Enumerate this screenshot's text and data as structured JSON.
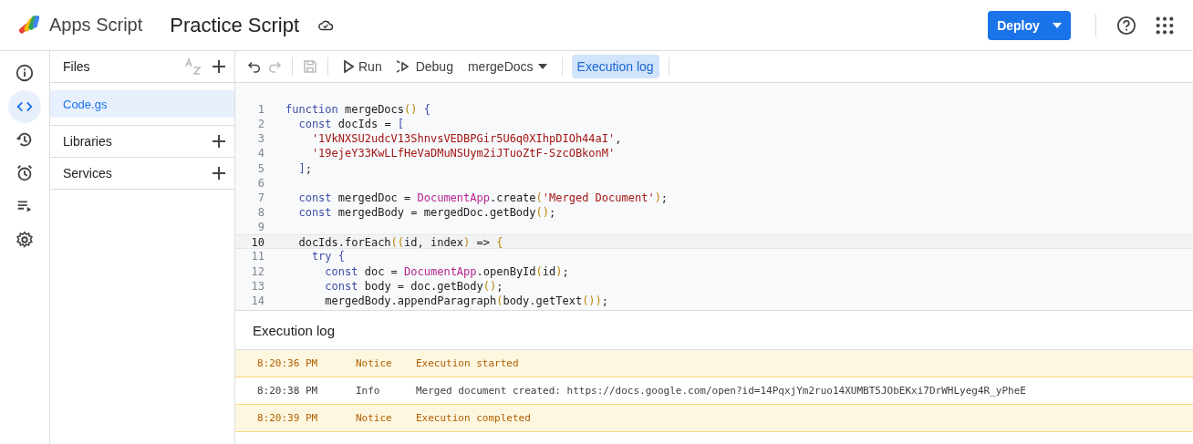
{
  "header": {
    "product": "Apps Script",
    "project_title": "Practice Script",
    "deploy_button": "Deploy"
  },
  "rail": [
    {
      "selected": false
    },
    {
      "selected": true
    },
    {
      "selected": false
    },
    {
      "selected": false
    },
    {
      "selected": false
    },
    {
      "selected": false
    }
  ],
  "files_panel": {
    "title": "Files",
    "files": [
      {
        "name": "Code.gs",
        "selected": true
      }
    ],
    "sections": [
      "Libraries",
      "Services"
    ]
  },
  "toolbar": {
    "run": "Run",
    "debug": "Debug",
    "function_select": "mergeDocs",
    "execution_log_button": {
      "label": "Execution log",
      "selected": true
    }
  },
  "code": [
    {
      "number": "1",
      "selected": false,
      "tokens": [
        {
          "kind": "keyword",
          "text": "function"
        },
        {
          "kind": "plain",
          "text": " mergeDocs"
        },
        {
          "kind": "paren",
          "text": "()"
        },
        {
          "kind": "brace",
          "text": " {"
        }
      ]
    },
    {
      "number": "2",
      "selected": false,
      "tokens": [
        {
          "kind": "keyword",
          "text": "  const"
        },
        {
          "kind": "plain",
          "text": " docIds = "
        },
        {
          "kind": "brace",
          "text": "["
        }
      ]
    },
    {
      "number": "3",
      "selected": false,
      "tokens": [
        {
          "kind": "string",
          "text": "    '1VkNXSU2udcV13ShnvsVEDBPGir5U6q0XIhpDIOh44aI'"
        },
        {
          "kind": "plain",
          "text": ","
        }
      ]
    },
    {
      "number": "4",
      "selected": false,
      "tokens": [
        {
          "kind": "string",
          "text": "    '19ejeY33KwLLfHeVaDMuNSUym2iJTuoZtF-SzcOBkonM'"
        }
      ]
    },
    {
      "number": "5",
      "selected": false,
      "tokens": [
        {
          "kind": "brace",
          "text": "  ]"
        },
        {
          "kind": "plain",
          "text": ";"
        }
      ]
    },
    {
      "number": "6",
      "selected": false
    },
    {
      "number": "7",
      "selected": false,
      "tokens": [
        {
          "kind": "keyword",
          "text": "  const"
        },
        {
          "kind": "plain",
          "text": " mergedDoc = "
        },
        {
          "kind": "class",
          "text": "DocumentApp"
        },
        {
          "kind": "plain",
          "text": ".create"
        },
        {
          "kind": "paren",
          "text": "("
        },
        {
          "kind": "string",
          "text": "'Merged Document'"
        },
        {
          "kind": "paren",
          "text": ")"
        },
        {
          "kind": "plain",
          "text": ";"
        }
      ]
    },
    {
      "number": "8",
      "selected": false,
      "tokens": [
        {
          "kind": "keyword",
          "text": "  const"
        },
        {
          "kind": "plain",
          "text": " mergedBody = mergedDoc.getBody"
        },
        {
          "kind": "paren",
          "text": "()"
        },
        {
          "kind": "plain",
          "text": ";"
        }
      ]
    },
    {
      "number": "9",
      "selected": false
    },
    {
      "number": "10",
      "selected": true,
      "tokens": [
        {
          "kind": "plain",
          "text": "  docIds.forEach"
        },
        {
          "kind": "paren",
          "text": "(("
        },
        {
          "kind": "plain",
          "text": "id, index"
        },
        {
          "kind": "paren",
          "text": ")"
        },
        {
          "kind": "plain",
          "text": " => "
        },
        {
          "kind": "paren",
          "text": "{"
        }
      ]
    },
    {
      "number": "11",
      "selected": false,
      "tokens": [
        {
          "kind": "keyword",
          "text": "    try"
        },
        {
          "kind": "brace",
          "text": " {"
        }
      ]
    },
    {
      "number": "12",
      "selected": false,
      "tokens": [
        {
          "kind": "keyword",
          "text": "      const"
        },
        {
          "kind": "plain",
          "text": " doc = "
        },
        {
          "kind": "class",
          "text": "DocumentApp"
        },
        {
          "kind": "plain",
          "text": ".openById"
        },
        {
          "kind": "paren",
          "text": "("
        },
        {
          "kind": "plain",
          "text": "id"
        },
        {
          "kind": "paren",
          "text": ")"
        },
        {
          "kind": "plain",
          "text": ";"
        }
      ]
    },
    {
      "number": "13",
      "selected": false,
      "tokens": [
        {
          "kind": "keyword",
          "text": "      const"
        },
        {
          "kind": "plain",
          "text": " body = doc.getBody"
        },
        {
          "kind": "paren",
          "text": "()"
        },
        {
          "kind": "plain",
          "text": ";"
        }
      ]
    },
    {
      "number": "14",
      "selected": false,
      "tokens": [
        {
          "kind": "plain",
          "text": "      mergedBody.appendParagraph"
        },
        {
          "kind": "paren",
          "text": "("
        },
        {
          "kind": "plain",
          "text": "body.getText"
        },
        {
          "kind": "paren",
          "text": "())"
        },
        {
          "kind": "plain",
          "text": ";"
        }
      ]
    }
  ],
  "execution_log": {
    "title": "Execution log",
    "rows": [
      {
        "time": "8:20:36 PM",
        "level": "Notice",
        "kind": "notice",
        "message": "Execution started"
      },
      {
        "time": "8:20:38 PM",
        "level": "Info",
        "kind": "info",
        "message": "Merged document created: https://docs.google.com/open?id=14PqxjYm2ruo14XUMBT5JObEKxi7DrWHLyeg4R_yPheE"
      },
      {
        "time": "8:20:39 PM",
        "level": "Notice",
        "kind": "notice",
        "message": "Execution completed"
      }
    ]
  }
}
